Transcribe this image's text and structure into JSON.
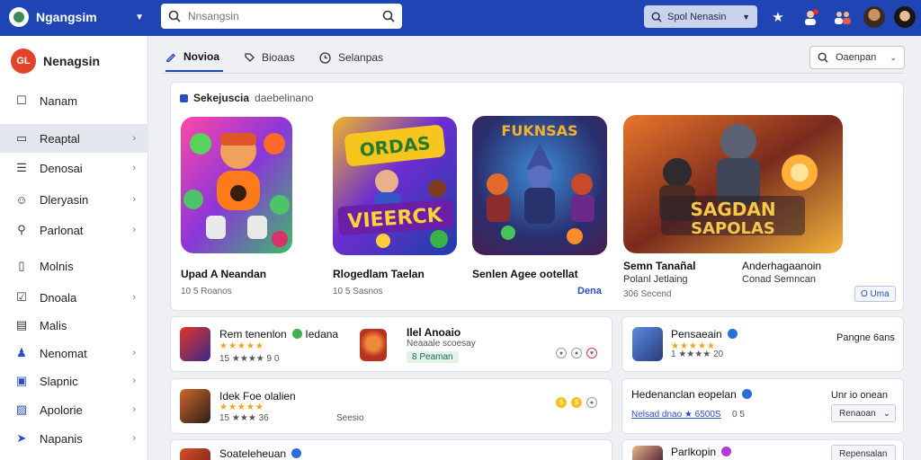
{
  "topbar": {
    "brand_name": "Ngangsim",
    "search_placeholder": "Nnsangsin",
    "secondary_search": "Spol Nenasin",
    "colors": {
      "bar": "#1f45b5"
    }
  },
  "sidebar": {
    "title": "Nenagsin",
    "logo_text": "GL",
    "items": [
      {
        "label": "Nanam",
        "icon": "square-icon",
        "chevron": false
      },
      {
        "label": "Reaptal",
        "icon": "card-icon",
        "chevron": true,
        "active": true
      },
      {
        "label": "Denosai",
        "icon": "list-icon",
        "chevron": true
      },
      {
        "label": "Dleryasin",
        "icon": "people-icon",
        "chevron": true
      },
      {
        "label": "Parlonat",
        "icon": "pin-icon",
        "chevron": true
      },
      {
        "label": "Molnis",
        "icon": "phone-icon",
        "chevron": false
      },
      {
        "label": "Dnoala",
        "icon": "checkbox-icon",
        "chevron": true
      },
      {
        "label": "Malis",
        "icon": "doc-icon",
        "chevron": false
      },
      {
        "label": "Nenomat",
        "icon": "people-blue-icon",
        "chevron": true
      },
      {
        "label": "Slapnic",
        "icon": "window-icon",
        "chevron": true
      },
      {
        "label": "Apolorie",
        "icon": "image-icon",
        "chevron": true
      },
      {
        "label": "Napanis",
        "icon": "send-icon",
        "chevron": true
      }
    ]
  },
  "tabs": {
    "items": [
      {
        "label": "Novioa",
        "icon": "pen-icon"
      },
      {
        "label": "Bioaas",
        "icon": "tag-icon"
      },
      {
        "label": "Selanpas",
        "icon": "clock-icon"
      }
    ],
    "right_button": "Oaenpan"
  },
  "featured": {
    "header_bold": "Sekejuscia",
    "header_sub": "daebelinano",
    "games": [
      {
        "name": "Upad A Neandan",
        "sub": "10 5 Roanos",
        "link": ""
      },
      {
        "name": "Rlogedlam Taelan",
        "sub": "10 5 Sasnos",
        "link": ""
      },
      {
        "name": "Senlen Agee ootellat",
        "sub": "",
        "link": "Dena"
      },
      {
        "name": "Semn Tanañal",
        "sub": "Polanl Jetlaing",
        "sub2": "306 Secend",
        "name2": "Anderhagaanoin",
        "sub3": "Conad Semncan",
        "button": "O Uma",
        "title_art": "SAGDAN SAPOLAS"
      }
    ],
    "art_text_2": "VIEERCK",
    "art_text_2b": "ORDAS",
    "art_text_3": "FUKNSAS"
  },
  "cards": [
    {
      "title": "Rem tenenlon",
      "badge": "Iedana",
      "stars": 5,
      "sub": "15 ★★★★ 9 0",
      "side_title": "Ilel Anoaio",
      "side_sub": "Neaaale scoesay",
      "tag": "8 Peaman"
    },
    {
      "title": "Pensaeain",
      "stars": 5,
      "sub": "1 ★★★★ 20",
      "right": "Pangne 6ans"
    },
    {
      "title": "Idek Foe olalien",
      "stars": 5,
      "sub": "15 ★★★ 36",
      "sub_extra": "Seesio"
    },
    {
      "title": "Hedenanclan eopelan",
      "sub": "Nelsad dnao ★ 6500S",
      "sub_extra": "0 5",
      "right": "Unr io onean",
      "drop": "Renaoan"
    },
    {
      "title": "Soateleheuan"
    },
    {
      "title": "Parlkopin",
      "drop": "Repensalan"
    }
  ]
}
